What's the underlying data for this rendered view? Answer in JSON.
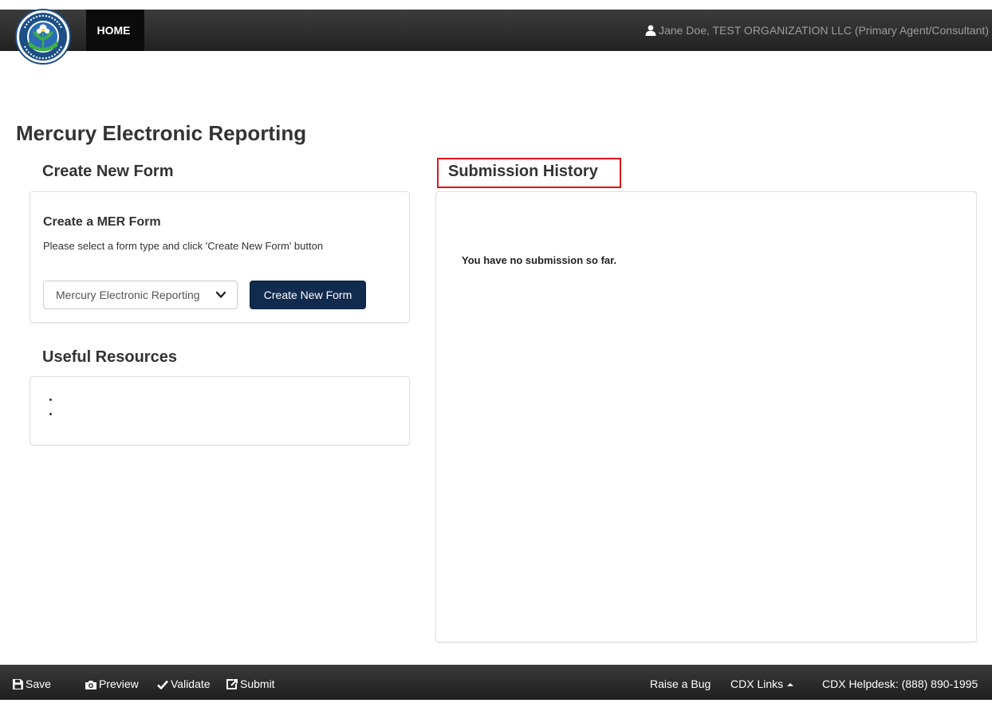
{
  "nav": {
    "home_label": "HOME",
    "user_label": "Jane Doe, TEST ORGANIZATION LLC (Primary Agent/Consultant)"
  },
  "logo": {
    "seal_text": "UNITED STATES ENVIRONMENTAL PROTECTION AGENCY",
    "colors": {
      "ring": "#1d4f86",
      "leaf": "#3fae49",
      "flower": "#ffffff"
    }
  },
  "page": {
    "title": "Mercury Electronic Reporting"
  },
  "create_section": {
    "heading": "Create New Form",
    "form_title": "Create a MER Form",
    "instructions": "Please select a form type and click 'Create New Form' button",
    "selected_form_type": "Mercury Electronic Reporting",
    "create_button_label": "Create New Form"
  },
  "resources_section": {
    "heading": "Useful Resources",
    "items": [
      "",
      ""
    ]
  },
  "history_section": {
    "heading": "Submission History",
    "empty_message": "You have no submission so far.",
    "highlight_color": "#e0141b"
  },
  "footer": {
    "save": "Save",
    "preview": "Preview",
    "validate": "Validate",
    "submit": "Submit",
    "raise_bug": "Raise a Bug",
    "cdx_links": "CDX Links",
    "helpdesk": "CDX Helpdesk: (888) 890-1995"
  },
  "colors": {
    "nav_bar": "#2b2b2b",
    "primary_button": "#102b4e",
    "highlight": "#e0141b"
  }
}
